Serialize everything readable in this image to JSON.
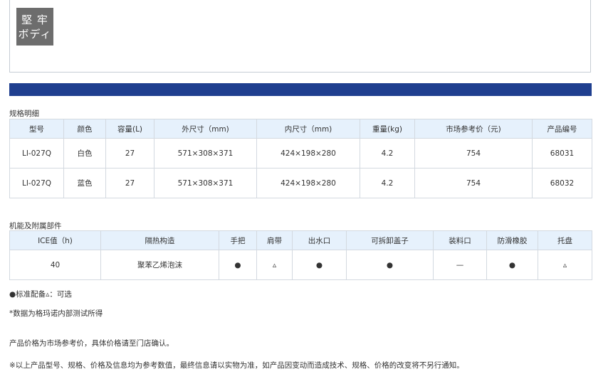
{
  "badge": {
    "line1": "堅 牢",
    "line2": "ボディ"
  },
  "colors": {
    "bar": "#1f3f8f",
    "header_bg": "#e6f1fc",
    "border": "#d3d9e0"
  },
  "spec_table": {
    "caption": "规格明细",
    "headers": [
      "型号",
      "颜色",
      "容量(L)",
      "外尺寸（mm)",
      "内尺寸（mm)",
      "重量(kg)",
      "市场参考价（元)",
      "产品编号"
    ],
    "rows": [
      [
        "LI-027Q",
        "白色",
        "27",
        "571×308×371",
        "424×198×280",
        "4.2",
        "754",
        "68031"
      ],
      [
        "LI-027Q",
        "蓝色",
        "27",
        "571×308×371",
        "424×198×280",
        "4.2",
        "754",
        "68032"
      ]
    ]
  },
  "feature_table": {
    "caption": "机能及附属部件",
    "headers": [
      "ICE值（h)",
      "隔热构造",
      "手把",
      "肩带",
      "出水口",
      "可拆卸盖子",
      "装料口",
      "防滑橡胶",
      "托盘"
    ],
    "row": [
      "40",
      "聚苯乙烯泡沫",
      "●",
      "▵",
      "●",
      "●",
      "—",
      "●",
      "▵"
    ]
  },
  "notes": {
    "legend": "●标准配备▵：可选",
    "data_source": "*数据为格玛诺内部测试所得",
    "price_note": "产品价格为市场参考价，具体价格请至门店确认。",
    "disclaimer": "※以上产品型号、规格、价格及信息均为参考数值，最终信息请以实物为准，如产品因变动而造成技术、规格、价格的改变将不另行通知。"
  }
}
